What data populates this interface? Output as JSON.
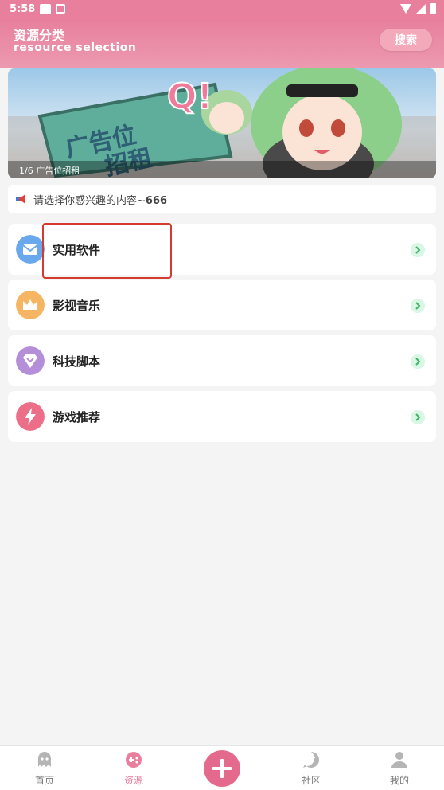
{
  "status_bar": {
    "time": "5:58"
  },
  "header": {
    "title_cn": "资源分类",
    "title_en": "resource selection",
    "search_label": "搜索"
  },
  "banner": {
    "caption": "1/6 广告位招租",
    "sign_line1": "广告位",
    "sign_line2": "招租"
  },
  "notice": {
    "text": "请选择你感兴趣的内容~",
    "emph": "666"
  },
  "categories": [
    {
      "label": "实用软件",
      "icon": "mail-icon",
      "color": "#6aa8ee"
    },
    {
      "label": "影视音乐",
      "icon": "crown-icon",
      "color": "#f5b562"
    },
    {
      "label": "科技脚本",
      "icon": "gem-icon",
      "color": "#b48ed8"
    },
    {
      "label": "游戏推荐",
      "icon": "lightning-icon",
      "color": "#ec6e88"
    }
  ],
  "bottom_nav": {
    "home": "首页",
    "resources": "资源",
    "community": "社区",
    "mine": "我的"
  },
  "colors": {
    "accent": "#e8809d",
    "chevron_bg": "#d9f7e4"
  }
}
